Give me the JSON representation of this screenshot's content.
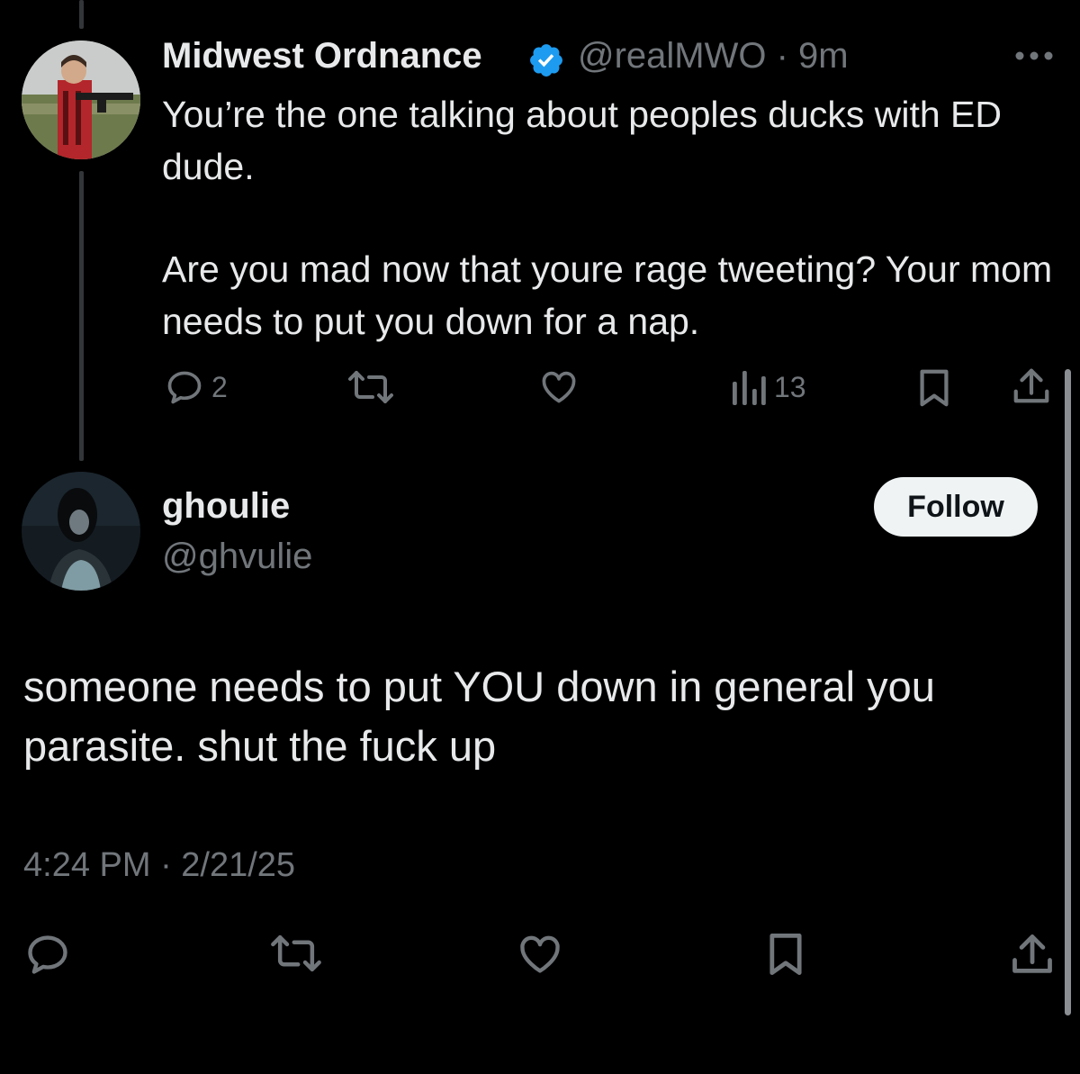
{
  "tweet": {
    "author_name": "Midwest Ordnance",
    "handle_time": "@realMWO · 9m",
    "paragraphs": [
      "You’re the one talking about peoples ducks with ED dude.",
      "Are you mad now that youre rage tweeting? Your mom needs to put you down for a nap."
    ],
    "actions": {
      "reply_count": "2",
      "views_count": "13"
    }
  },
  "reply": {
    "author_name": "ghoulie",
    "handle": "@ghvulie",
    "follow_label": "Follow",
    "text": "someone needs to put YOU down in general you parasite. shut the fuck up",
    "timestamp": "4:24 PM · 2/21/25"
  },
  "colors": {
    "background": "#000000",
    "text": "#e7e9ea",
    "muted": "#71767b",
    "verified": "#1d9bf0",
    "follow_bg": "#eff3f4"
  },
  "icons": [
    "more-icon",
    "verified-icon",
    "reply-icon",
    "retweet-icon",
    "like-icon",
    "views-icon",
    "bookmark-icon",
    "share-icon"
  ]
}
